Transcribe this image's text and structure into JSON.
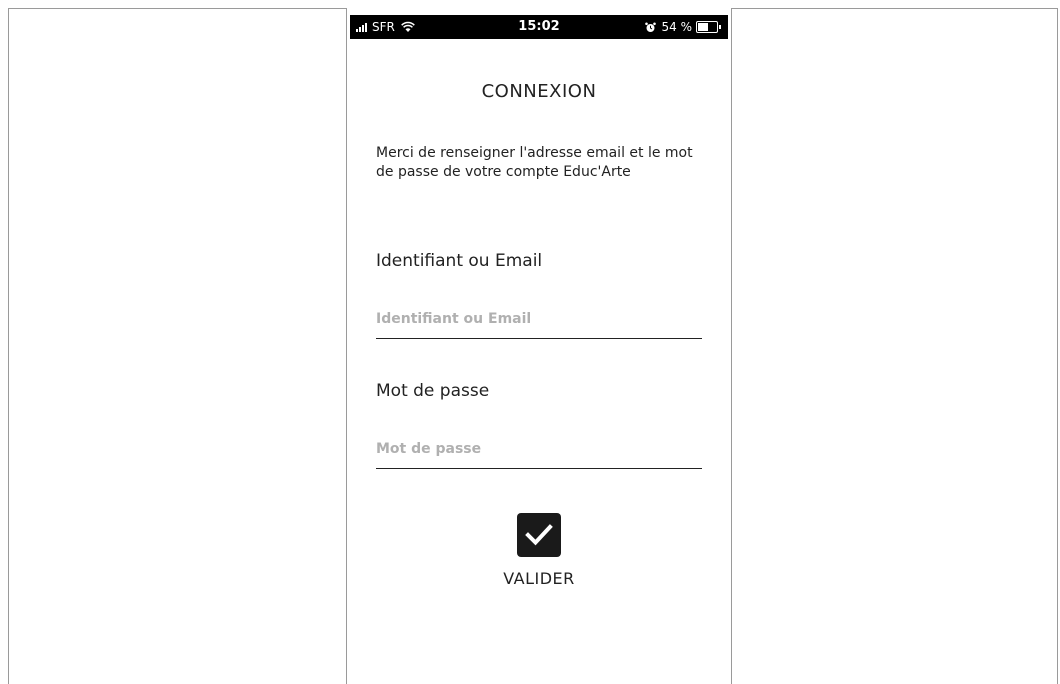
{
  "status_bar": {
    "carrier": "SFR",
    "time": "15:02",
    "battery_text": "54 %",
    "battery_level": 0.54
  },
  "login": {
    "title": "CONNEXION",
    "intro": "Merci de renseigner l'adresse email et le mot de passe de votre compte Educ'Arte",
    "identifier": {
      "label": "Identifiant ou Email",
      "placeholder": "Identifiant ou Email",
      "value": ""
    },
    "password": {
      "label": "Mot de passe",
      "placeholder": "Mot de passe",
      "value": ""
    },
    "submit_label": "VALIDER"
  },
  "icons": {
    "signal": "signal-icon",
    "wifi": "wifi-icon",
    "alarm": "alarm-icon",
    "battery": "battery-icon",
    "submit": "checkmark-icon"
  }
}
